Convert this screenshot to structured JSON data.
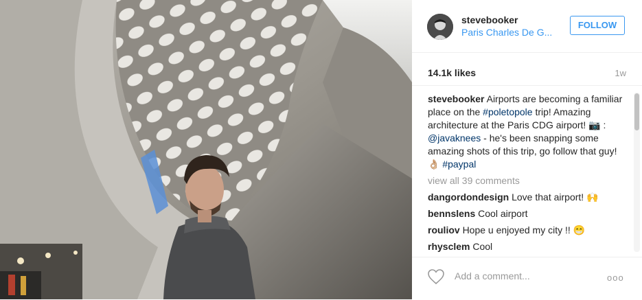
{
  "post": {
    "username": "stevebooker",
    "location": "Paris Charles De G...",
    "follow_label": "FOLLOW",
    "likes": "14.1k likes",
    "age": "1w",
    "photo_icon": "camera-emoji",
    "caption": {
      "user": "stevebooker",
      "t1": " Airports are becoming a familiar place on the ",
      "tag1": "#poletopole",
      "t2": " trip! Amazing architecture at the Paris CDG airport! ",
      "emoji_camera": "📷",
      "t3": " : ",
      "mention": "@javaknees",
      "t4": " - he's been snapping some amazing shots of this trip, go follow that guy! ",
      "emoji_ok": "👌",
      "emoji_tone": "🏼",
      "t5": " ",
      "tag2": "#paypal"
    },
    "view_all": "view all 39 comments",
    "comments": [
      {
        "user": "dangordondesign",
        "text": "Love that airport! ",
        "emoji": "🙌"
      },
      {
        "user": "bennslens",
        "text": "Cool airport",
        "emoji": ""
      },
      {
        "user": "rouliov",
        "text": "Hope u enjoyed my city !! ",
        "emoji": "😁"
      },
      {
        "user": "rhysclem",
        "text": "Cool",
        "emoji": ""
      }
    ],
    "comment_placeholder": "Add a comment...",
    "more_label": "ooo",
    "icons": {
      "heart": "heart-outline-icon",
      "more": "more-options-icon"
    },
    "colors": {
      "link": "#3897f0",
      "hashtag": "#003569",
      "muted": "#999999"
    }
  }
}
